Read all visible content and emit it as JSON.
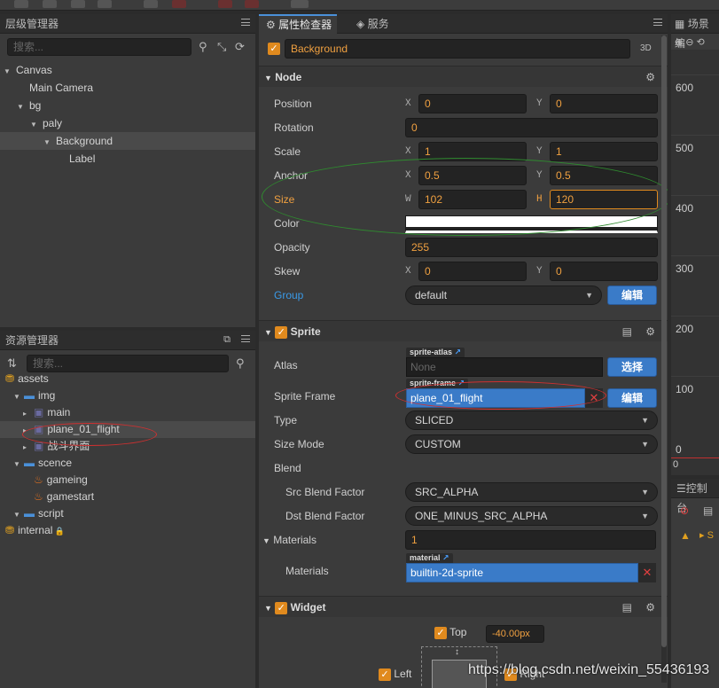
{
  "hierarchy": {
    "title": "层级管理器",
    "search_placeholder": "搜索...",
    "nodes": [
      {
        "label": "Canvas",
        "depth": 0,
        "expanded": true
      },
      {
        "label": "Main Camera",
        "depth": 1,
        "expanded": false
      },
      {
        "label": "bg",
        "depth": 1,
        "expanded": true
      },
      {
        "label": "paly",
        "depth": 2,
        "expanded": true
      },
      {
        "label": "Background",
        "depth": 3,
        "expanded": true,
        "selected": true
      },
      {
        "label": "Label",
        "depth": 4,
        "expanded": false
      }
    ]
  },
  "assets": {
    "title": "资源管理器",
    "search_placeholder": "搜索...",
    "items": [
      {
        "label": "assets",
        "depth": 0,
        "icon": "db-icon"
      },
      {
        "label": "img",
        "depth": 1,
        "icon": "folder-icon"
      },
      {
        "label": "main",
        "depth": 2,
        "icon": "image-icon"
      },
      {
        "label": "plane_01_flight",
        "depth": 2,
        "icon": "image-icon",
        "selected": true
      },
      {
        "label": "战斗界面",
        "depth": 2,
        "icon": "image-icon"
      },
      {
        "label": "scence",
        "depth": 1,
        "icon": "folder-icon"
      },
      {
        "label": "gameing",
        "depth": 2,
        "icon": "fire-icon"
      },
      {
        "label": "gamestart",
        "depth": 2,
        "icon": "fire-icon"
      },
      {
        "label": "script",
        "depth": 1,
        "icon": "folder-icon"
      },
      {
        "label": "internal",
        "depth": 0,
        "icon": "db-icon",
        "locked": true
      }
    ]
  },
  "inspector": {
    "tab_inspector": "属性检查器",
    "tab_service": "服务",
    "node_name": "Background",
    "badge_3d": "3D",
    "node_section": "Node",
    "position": {
      "label": "Position",
      "x": "0",
      "y": "0"
    },
    "rotation": {
      "label": "Rotation",
      "value": "0"
    },
    "scale": {
      "label": "Scale",
      "x": "1",
      "y": "1"
    },
    "anchor": {
      "label": "Anchor",
      "x": "0.5",
      "y": "0.5"
    },
    "size": {
      "label": "Size",
      "w": "102",
      "h": "120"
    },
    "color": {
      "label": "Color",
      "value": "#ffffff"
    },
    "opacity": {
      "label": "Opacity",
      "value": "255"
    },
    "skew": {
      "label": "Skew",
      "x": "0",
      "y": "0"
    },
    "group": {
      "label": "Group",
      "value": "default",
      "edit": "编辑"
    },
    "axes": {
      "x": "X",
      "y": "Y",
      "w": "W",
      "h": "H"
    },
    "sprite_section": "Sprite",
    "atlas": {
      "label": "Atlas",
      "tag": "sprite-atlas",
      "value": "None",
      "button": "选择"
    },
    "sprite_frame": {
      "label": "Sprite Frame",
      "tag": "sprite-frame",
      "value": "plane_01_flight",
      "button": "编辑"
    },
    "type": {
      "label": "Type",
      "value": "SLICED"
    },
    "size_mode": {
      "label": "Size Mode",
      "value": "CUSTOM"
    },
    "blend": {
      "label": "Blend"
    },
    "src_blend": {
      "label": "Src Blend Factor",
      "value": "SRC_ALPHA"
    },
    "dst_blend": {
      "label": "Dst Blend Factor",
      "value": "ONE_MINUS_SRC_ALPHA"
    },
    "materials_count": {
      "label": "Materials",
      "value": "1"
    },
    "materials": {
      "label": "Materials",
      "tag": "material",
      "value": "builtin-2d-sprite"
    },
    "widget_section": "Widget",
    "widget_top": {
      "label": "Top",
      "value": "-40.00px"
    },
    "widget_left": {
      "label": "Left"
    },
    "widget_right": {
      "label": "Right"
    }
  },
  "scene": {
    "title": "场景编",
    "y_ticks": [
      "600",
      "500",
      "400",
      "300",
      "200",
      "100",
      "0"
    ],
    "x_tick": "0"
  },
  "console": {
    "title": "控制台",
    "warning_text": "S"
  },
  "watermark": "https://blog.csdn.net/weixin_55436193",
  "colors": {
    "accent": "#3a7bc8",
    "orange": "#e08a1e",
    "highlight": "#f0a040"
  }
}
